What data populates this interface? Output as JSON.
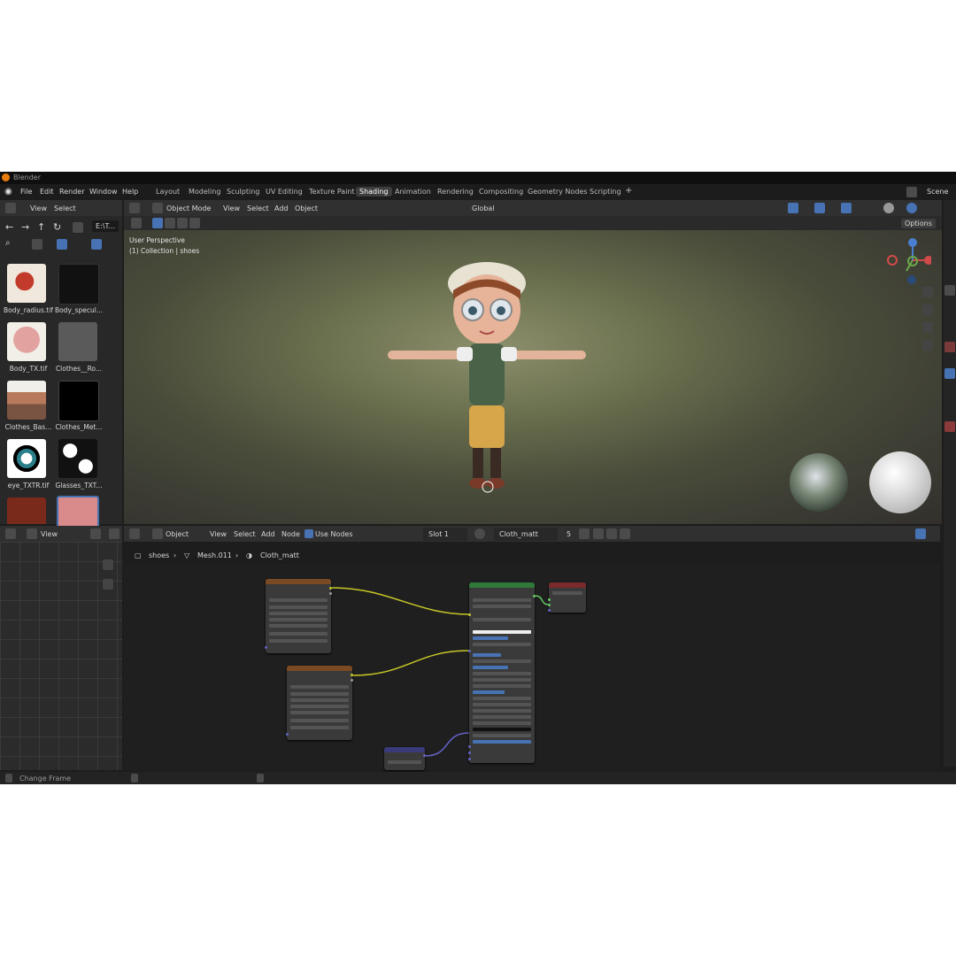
{
  "app_title": "Blender",
  "menus": [
    "File",
    "Edit",
    "Render",
    "Window",
    "Help"
  ],
  "workspaces": [
    "Layout",
    "Modeling",
    "Sculpting",
    "UV Editing",
    "Texture Paint",
    "Shading",
    "Animation",
    "Rendering",
    "Compositing",
    "Geometry Nodes",
    "Scripting"
  ],
  "active_workspace": "Shading",
  "scene": "Scene",
  "file_browser": {
    "menus": [
      "View",
      "Select"
    ],
    "path": "E:\\T...",
    "items": [
      "Body_radius.tif",
      "Body_specul...",
      "Body_TX.tif",
      "Clothes__Ro...",
      "Clothes_Bas...",
      "Clothes_Met...",
      "eye_TXTR.tif",
      "Glasses_TXT..."
    ]
  },
  "viewport": {
    "mode": "Object Mode",
    "menus": [
      "View",
      "Select",
      "Add",
      "Object"
    ],
    "transform": "Global",
    "options": "Options",
    "overlay_line1": "User Perspective",
    "overlay_line2": "(1) Collection | shoes"
  },
  "image_editor": {
    "view": "View"
  },
  "node_editor": {
    "type": "Object",
    "menus": [
      "View",
      "Select",
      "Add",
      "Node"
    ],
    "use_nodes": "Use Nodes",
    "slot": "Slot 1",
    "material": "Cloth_matt",
    "users": "5",
    "breadcrumb": [
      "shoes",
      "Mesh.011",
      "Cloth_matt"
    ]
  },
  "status": {
    "left": "Change Frame"
  },
  "colors": {
    "accent": "#4772b3",
    "header": "#303030",
    "bg": "#1d1d1d"
  }
}
